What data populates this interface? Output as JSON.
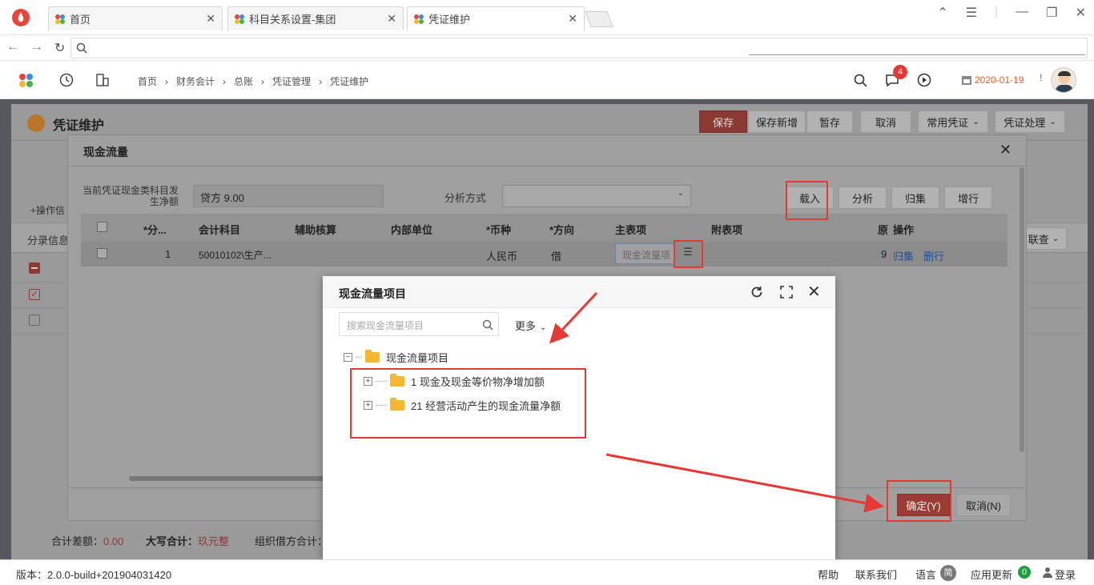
{
  "tabs": [
    {
      "label": "首页"
    },
    {
      "label": "科目关系设置-集团"
    },
    {
      "label": "凭证维护"
    }
  ],
  "breadcrumb": [
    "首页",
    "财务会计",
    "总账",
    "凭证管理",
    "凭证维护"
  ],
  "header": {
    "notification_count": "4",
    "date": "2020-01-19"
  },
  "page": {
    "title": "凭证维护",
    "buttons": [
      "保存",
      "保存新增",
      "暂存",
      "取消",
      "常用凭证",
      "凭证处理"
    ],
    "left_label_ops": "+操作信",
    "left_label_entry": "分录信息",
    "right_dropdown": "联查"
  },
  "footer_bar": {
    "diff_label": "合计差额：",
    "diff_value": "0.00",
    "upper_label": "大写合计：",
    "upper_value": "玖元整",
    "org_label": "组织借方合计："
  },
  "dialog": {
    "title": "现金流量",
    "subject_label": "当前凭证现金类科目发生净额",
    "subject_value": "贷方 9.00",
    "analysis_label": "分析方式",
    "buttons": [
      "载入",
      "分析",
      "归集",
      "增行"
    ],
    "columns": [
      "*分...",
      "会计科目",
      "辅助核算",
      "内部单位",
      "*币种",
      "*方向",
      "主表项",
      "附表项",
      "原",
      "操作"
    ],
    "row": {
      "no": "1",
      "subject": "50010102\\生产...",
      "currency": "人民币",
      "direction": "借",
      "main_placeholder": "现金流量项",
      "orig": "9",
      "op1": "归集",
      "op2": "删行"
    },
    "ok": "确定(Y)",
    "cancel": "取消(N)"
  },
  "popup": {
    "title": "现金流量项目",
    "search_placeholder": "搜索现金流量项目",
    "more": "更多",
    "tree_root": "现金流量项目",
    "tree_items": [
      "1 现金及现金等价物净增加额",
      "21 经营活动产生的现金流量净额"
    ]
  },
  "statusbar": {
    "version": "版本：2.0.0-build+201904031420",
    "help": "帮助",
    "contact": "联系我们",
    "lang": "语言",
    "lang_badge": "简",
    "update": "应用更新",
    "update_count": "0",
    "login": "登录"
  }
}
